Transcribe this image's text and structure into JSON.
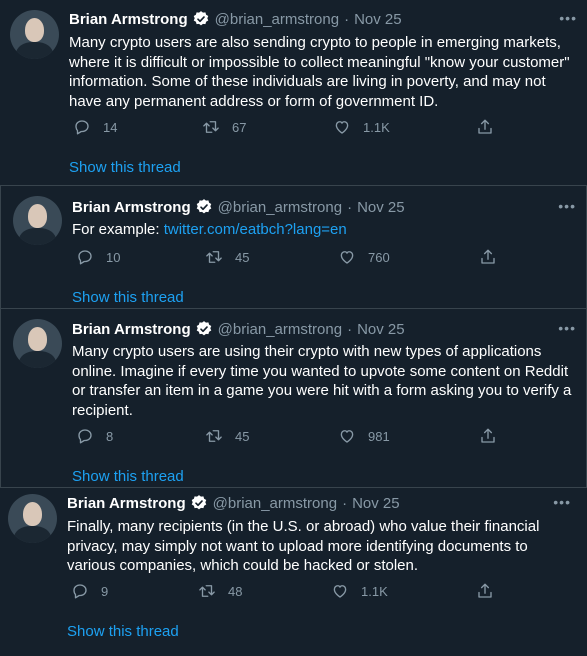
{
  "tweets": [
    {
      "name": "Brian Armstrong",
      "handle": "@brian_armstrong",
      "dot": "·",
      "date": "Nov 25",
      "more": "•••",
      "text": "Many crypto users are also sending crypto to people in emerging markets, where it is difficult or impossible to collect meaningful \"know your customer\" information. Some of these individuals are living in poverty, and may not have any permanent address or form of government ID.",
      "replies": "14",
      "retweets": "67",
      "likes": "1.1K",
      "thread_label": "Show this thread"
    },
    {
      "name": "Brian Armstrong",
      "handle": "@brian_armstrong",
      "dot": "·",
      "date": "Nov 25",
      "more": "•••",
      "text_prefix": "For example: ",
      "link": "twitter.com/eatbch?lang=en",
      "replies": "10",
      "retweets": "45",
      "likes": "760",
      "thread_label": "Show this thread"
    },
    {
      "name": "Brian Armstrong",
      "handle": "@brian_armstrong",
      "dot": "·",
      "date": "Nov 25",
      "more": "•••",
      "text": "Many crypto users are using their crypto with new types of applications online. Imagine if every time you wanted to upvote some content on Reddit or transfer an item in a game you were hit with a form asking you to verify a recipient.",
      "replies": "8",
      "retweets": "45",
      "likes": "981",
      "thread_label": "Show this thread"
    },
    {
      "name": "Brian Armstrong",
      "handle": "@brian_armstrong",
      "dot": "·",
      "date": "Nov 25",
      "more": "•••",
      "text": "Finally, many recipients (in the U.S. or abroad) who value their financial privacy, may simply not want to upload more identifying documents to various companies, which could be hacked or stolen.",
      "replies": "9",
      "retweets": "48",
      "likes": "1.1K",
      "thread_label": "Show this thread"
    }
  ],
  "colors": {
    "background": "#15202b",
    "text": "#ffffff",
    "muted": "#8899a6",
    "accent": "#1da1f2",
    "border": "#38444d"
  }
}
